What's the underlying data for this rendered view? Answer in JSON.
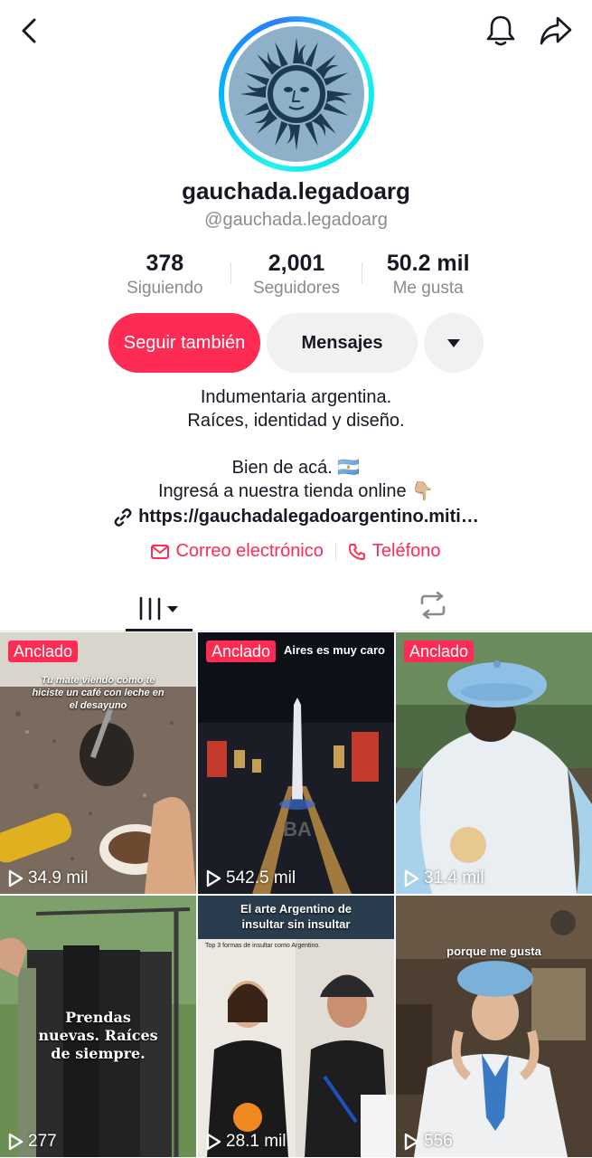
{
  "profile": {
    "display_name": "gauchada.legadoarg",
    "handle": "@gauchada.legadoarg"
  },
  "stats": [
    {
      "value": "378",
      "label": "Siguiendo"
    },
    {
      "value": "2,001",
      "label": "Seguidores"
    },
    {
      "value": "50.2 mil",
      "label": "Me gusta"
    }
  ],
  "actions": {
    "follow_label": "Seguir también",
    "message_label": "Mensajes"
  },
  "bio": {
    "line1": "Indumentaria argentina.",
    "line2": "Raíces, identidad y diseño.",
    "line3": "Bien de acá. 🇦🇷",
    "line4": "Ingresá a nuestra tienda online 👇🏼",
    "link": "https://gauchadalegadoargentino.miti…"
  },
  "contact": {
    "email_label": "Correo electrónico",
    "phone_label": "Teléfono"
  },
  "colors": {
    "accent": "#fe2c55",
    "text": "#161823",
    "secondary": "#8a8b91"
  },
  "videos": [
    {
      "pinned": "Anclado",
      "views": "34.9 mil",
      "caption": "Tu mate viendo cómo te hiciste un café con leche en el desayuno"
    },
    {
      "pinned": "Anclado",
      "views": "542.5 mil",
      "caption": "Aires es muy caro"
    },
    {
      "pinned": "Anclado",
      "views": "31.4 mil",
      "caption": ""
    },
    {
      "pinned": "",
      "views": "277",
      "caption": "Prendas nuevas. Raíces de siempre."
    },
    {
      "pinned": "",
      "views": "28.1 mil",
      "caption": "El arte Argentino de insultar sin insultar"
    },
    {
      "pinned": "",
      "views": "556",
      "caption": "porque me gusta"
    }
  ],
  "video_extra": {
    "subtitle_5": "Top 3 formas de insultar como Argentino."
  }
}
